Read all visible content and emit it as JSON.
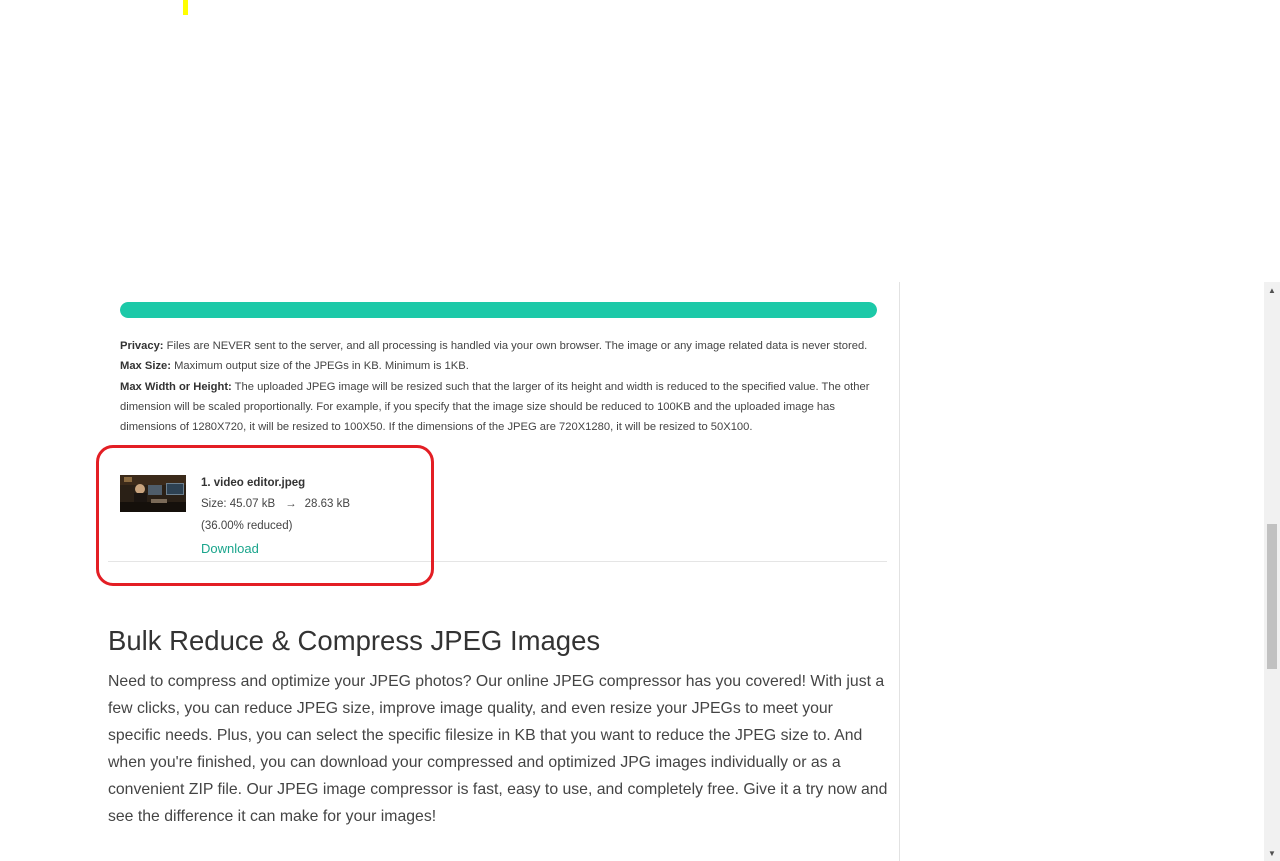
{
  "progress": {
    "value_percent": 100,
    "color": "#1cc9a8"
  },
  "info": {
    "privacy_label": "Privacy:",
    "privacy_text": " Files are NEVER sent to the server, and all processing is handled via your own browser. The image or any image related data is never stored.",
    "max_size_label": "Max Size:",
    "max_size_text": " Maximum output size of the JPEGs in KB. Minimum is 1KB.",
    "max_dim_label": "Max Width or Height:",
    "max_dim_text": " The uploaded JPEG image will be resized such that the larger of its height and width is reduced to the specified value. The other dimension will be scaled proportionally. For example, if you specify that the image size should be reduced to 100KB and the uploaded image has dimensions of 1280X720, it will be resized to 100X50. If the dimensions of the JPEG are 720X1280, it will be resized to 50X100."
  },
  "file": {
    "name": "1. video editor.jpeg",
    "size_prefix": "Size: 45.07 kB",
    "arrow": "→",
    "size_after": "28.63 kB",
    "reduced": "(36.00% reduced)",
    "download_label": "Download"
  },
  "section": {
    "title": "Bulk Reduce & Compress JPEG Images",
    "body": "Need to compress and optimize your JPEG photos? Our online JPEG compressor has you covered! With just a few clicks, you can reduce JPEG size, improve image quality, and even resize your JPEGs to meet your specific needs. Plus, you can select the specific filesize in KB that you want to reduce the JPEG size to. And when you're finished, you can download your compressed and optimized JPG images individually or as a convenient ZIP file. Our JPEG image compressor is fast, easy to use, and completely free. Give it a try now and see the difference it can make for your images!"
  },
  "scrollbar": {
    "up_arrow": "▲",
    "down_arrow": "▼"
  },
  "colors": {
    "accent": "#1cc9a8",
    "link": "#1aa58c",
    "highlight": "#e31e24"
  }
}
